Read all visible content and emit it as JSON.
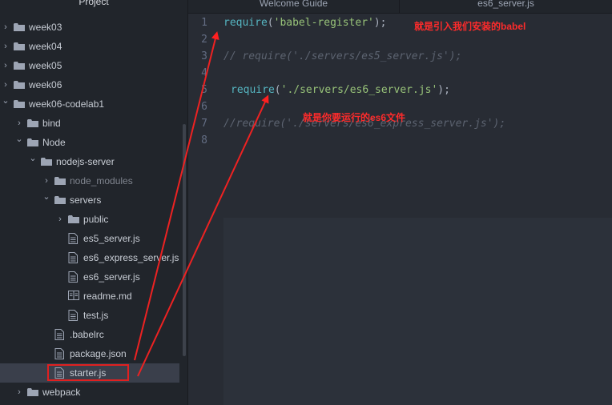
{
  "sidebar": {
    "title": "Project",
    "items": [
      {
        "label": "week03",
        "type": "folder",
        "open": false
      },
      {
        "label": "week04",
        "type": "folder",
        "open": false
      },
      {
        "label": "week05",
        "type": "folder",
        "open": false
      },
      {
        "label": "week06",
        "type": "folder",
        "open": false
      },
      {
        "label": "week06-codelab1",
        "type": "folder",
        "open": true
      },
      {
        "label": "bind",
        "type": "folder",
        "open": false
      },
      {
        "label": "Node",
        "type": "folder",
        "open": true
      },
      {
        "label": "nodejs-server",
        "type": "folder",
        "open": true
      },
      {
        "label": "node_modules",
        "type": "folder",
        "open": false
      },
      {
        "label": "servers",
        "type": "folder",
        "open": true
      },
      {
        "label": "public",
        "type": "folder",
        "open": false
      },
      {
        "label": "es5_server.js",
        "type": "file"
      },
      {
        "label": "es6_express_server.js",
        "type": "file"
      },
      {
        "label": "es6_server.js",
        "type": "file"
      },
      {
        "label": "readme.md",
        "type": "markdown"
      },
      {
        "label": "test.js",
        "type": "file"
      },
      {
        "label": ".babelrc",
        "type": "file"
      },
      {
        "label": "package.json",
        "type": "file"
      },
      {
        "label": "starter.js",
        "type": "file",
        "selected": true
      },
      {
        "label": "webpack",
        "type": "folder",
        "open": false
      }
    ]
  },
  "tabs": [
    {
      "label": "Welcome Guide"
    },
    {
      "label": "es6_server.js"
    }
  ],
  "editor": {
    "line_numbers": [
      "1",
      "2",
      "3",
      "4",
      "5",
      "6",
      "7",
      "8"
    ],
    "lines": {
      "l1_fn": "require",
      "l1_open": "(",
      "l1_str": "'babel-register'",
      "l1_close": ");",
      "l3": "// require('./servers/es5_server.js');",
      "l5_fn": "require",
      "l5_open": "(",
      "l5_str": "'./servers/es6_server.js'",
      "l5_close": ");",
      "l7": "//require('./servers/es6_express_server.js');"
    }
  },
  "annotations": {
    "babel_note": "就是引入我们安装的babel",
    "es6_note": "就是你要运行的es6文件"
  },
  "colors": {
    "annotation": "#ff2b2b",
    "selection": "#3a3f4b"
  },
  "icons": {
    "folder": "folder-icon",
    "file": "file-icon",
    "markdown": "markdown-icon",
    "chevron_right": "chevron-right-icon",
    "chevron_down": "chevron-down-icon"
  }
}
